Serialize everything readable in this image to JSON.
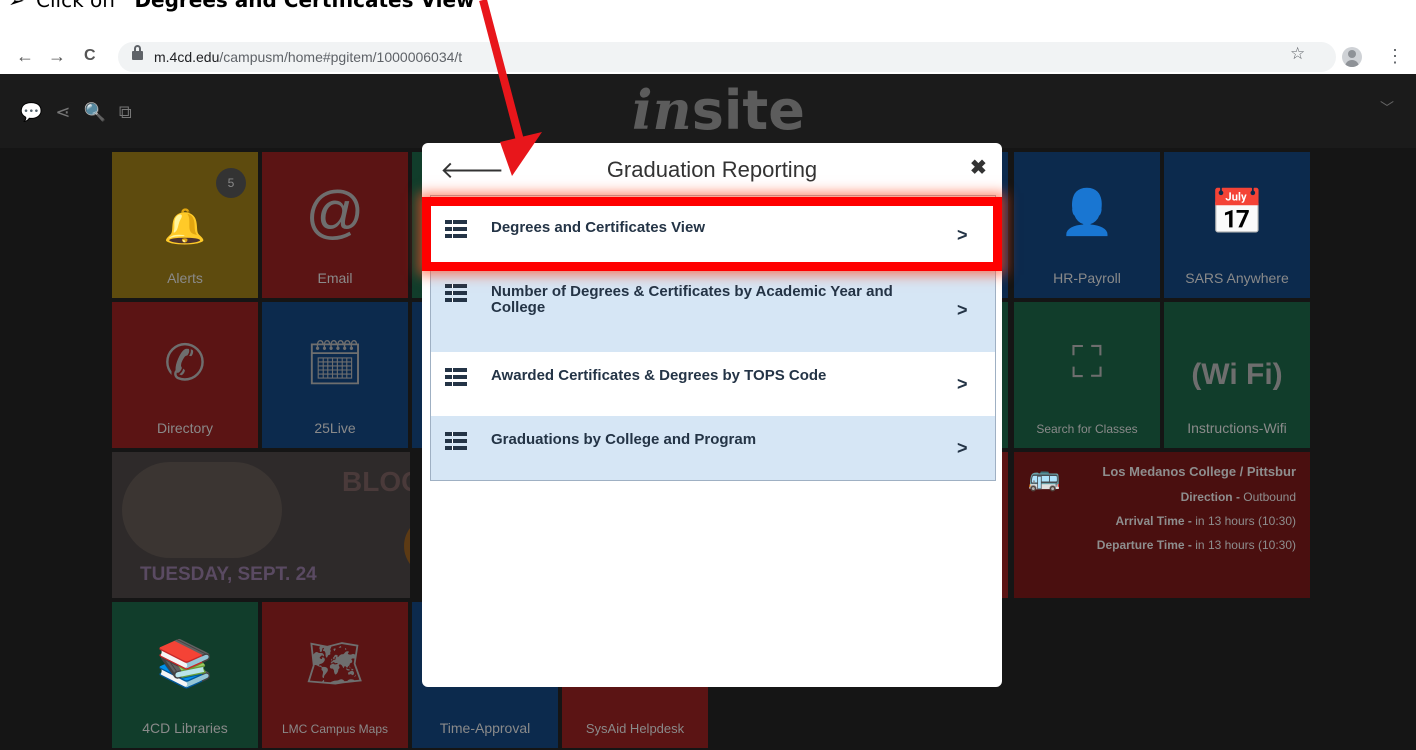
{
  "instruction": {
    "prefix": "Click on ",
    "bold": "“Degrees and Certificates View”"
  },
  "browser": {
    "back_label": "←",
    "forward_label": "→",
    "reload_label": "C",
    "url_host": "m.4cd.edu",
    "url_path": "/campusm/home#pgitem/1000006034/t",
    "star_label": "☆",
    "menu_label": "⋮"
  },
  "app": {
    "logo_in": "in",
    "logo_site": "site",
    "header_icons": "💬 ⋖ 🔍 ⧉",
    "tiles": {
      "alerts": "Alerts",
      "alerts_badge": "5",
      "email": "Email",
      "hr_payroll": "HR-Payroll",
      "sars": "SARS Anywhere",
      "directory": "Directory",
      "live25": "25Live",
      "search_classes": "Search for Classes",
      "wifi": "Instructions-Wifi",
      "libraries": "4CD Libraries",
      "campus_maps": "LMC Campus Maps",
      "time_approval": "Time-Approval",
      "sysaid": "SysAid Helpdesk"
    },
    "banner": {
      "title": "BLOC",
      "date": "TUESDAY, SEPT. 24"
    },
    "bus": {
      "route": "Los Medanos College / Pittsbur",
      "direction_label": "Direction - ",
      "direction_value": "Outbound",
      "arrival_label": "Arrival Time - ",
      "arrival_value": "in 13 hours (10:30)",
      "departure_label": "Departure Time - ",
      "departure_value": "in 13 hours (10:30)"
    }
  },
  "modal": {
    "title": "Graduation Reporting",
    "back_label": "🡐",
    "close_label": "✖",
    "items": [
      {
        "label": "Degrees and Certificates View",
        "chevron": ">"
      },
      {
        "label": "Number of Degrees & Certificates by Academic Year and College",
        "chevron": ">"
      },
      {
        "label": "Awarded Certificates & Degrees by TOPS Code",
        "chevron": ">"
      },
      {
        "label": "Graduations by College and Program",
        "chevron": ">"
      }
    ]
  },
  "colors": {
    "highlight": "#ff0000",
    "arrow": "#e8161b",
    "row_alt": "#d6e6f5",
    "row_text": "#243446"
  }
}
